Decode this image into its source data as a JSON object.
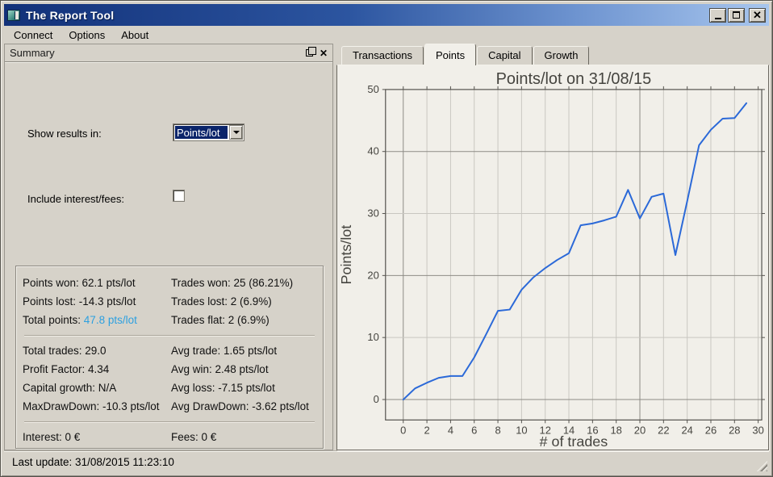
{
  "window": {
    "title": "The Report Tool"
  },
  "window_controls": {
    "minimize": "minimize",
    "maximize": "maximize",
    "close": "✕"
  },
  "menu": {
    "items": [
      "Connect",
      "Options",
      "About"
    ]
  },
  "summary": {
    "title": "Summary",
    "close_glyph": "✕",
    "show_results_label": "Show results in:",
    "show_results_value": "Points/lot",
    "include_fees_label": "Include interest/fees:",
    "include_fees_checked": false,
    "stats_groups": [
      [
        {
          "left": "Points won: 62.1 pts/lot",
          "right": "Trades won: 25 (86.21%)"
        },
        {
          "left": "Points lost: -14.3 pts/lot",
          "right": "Trades lost: 2 (6.9%)"
        },
        {
          "left": "Total points: ",
          "left_accent": "47.8 pts/lot",
          "right": "Trades flat: 2 (6.9%)"
        }
      ],
      [
        {
          "left": "Total trades: 29.0",
          "right": "Avg trade: 1.65 pts/lot"
        },
        {
          "left": "Profit Factor: 4.34",
          "right": "Avg win: 2.48 pts/lot"
        },
        {
          "left": "Capital growth: N/A",
          "right": "Avg loss: -7.15 pts/lot"
        },
        {
          "left": "MaxDrawDown: -10.3 pts/lot",
          "right": "Avg DrawDown: -3.62 pts/lot"
        }
      ],
      [
        {
          "left": "Interest: 0 €",
          "right": "Fees: 0 €"
        }
      ]
    ]
  },
  "statusbar": {
    "last_update": "Last update: 31/08/2015 11:23:10"
  },
  "tabs": [
    {
      "label": "Transactions",
      "active": false
    },
    {
      "label": "Points",
      "active": true
    },
    {
      "label": "Capital",
      "active": false
    },
    {
      "label": "Growth",
      "active": false
    }
  ],
  "colors": {
    "accent_text": "#2da0e0",
    "chart_line": "#2b69d8",
    "grid_minor": "#c9c7c1",
    "grid_major": "#8d8b85",
    "frame": "#55534e",
    "chart_text": "#45443f"
  },
  "chart_data": {
    "type": "line",
    "title": "Points/lot on 31/08/15",
    "xlabel": "# of trades",
    "ylabel": "Points/lot",
    "x": [
      0,
      1,
      2,
      3,
      4,
      5,
      6,
      7,
      8,
      9,
      10,
      11,
      12,
      13,
      14,
      15,
      16,
      17,
      18,
      19,
      20,
      21,
      22,
      23,
      24,
      25,
      26,
      27,
      28,
      29
    ],
    "values": [
      0,
      1.8,
      2.7,
      3.5,
      3.8,
      3.8,
      6.8,
      10.5,
      14.3,
      14.5,
      17.7,
      19.7,
      21.2,
      22.5,
      23.6,
      28.1,
      28.4,
      28.9,
      29.5,
      33.8,
      29.2,
      32.7,
      33.2,
      23.3,
      32.0,
      41.0,
      43.5,
      45.3,
      45.4,
      47.8
    ],
    "xlim": [
      -1.5,
      30.3
    ],
    "ylim": [
      -3.3,
      50
    ],
    "xticks": [
      0,
      2,
      4,
      6,
      8,
      10,
      12,
      14,
      16,
      18,
      20,
      22,
      24,
      26,
      28,
      30
    ],
    "yticks": [
      0,
      10,
      20,
      30,
      40,
      50
    ],
    "grid": true,
    "legend": "none",
    "line_color": "#2b69d8"
  }
}
